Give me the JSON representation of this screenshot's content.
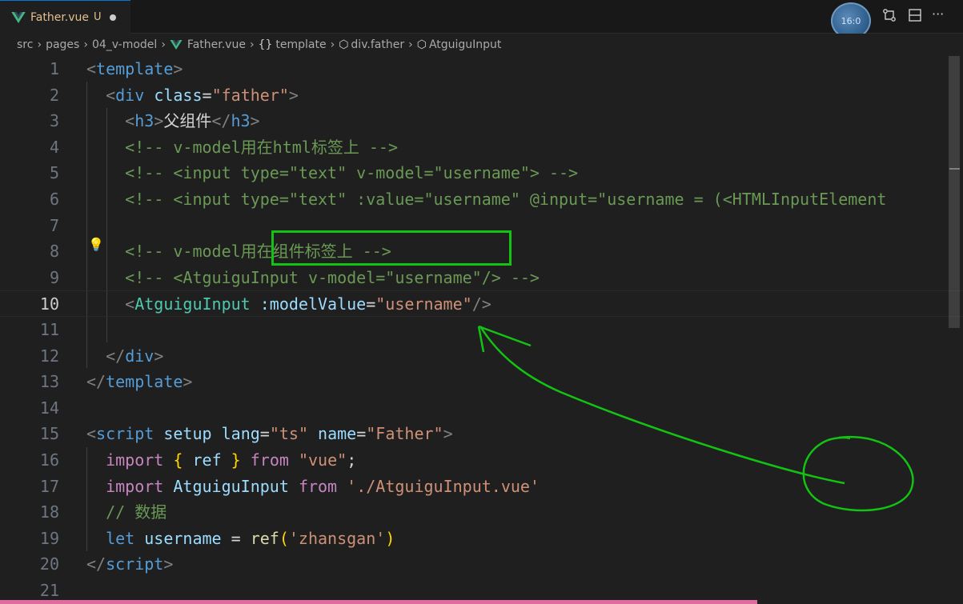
{
  "tab": {
    "title": "Father.vue",
    "badge": "U"
  },
  "avatar": {
    "text": "16:0"
  },
  "breadcrumb": [
    "src",
    "pages",
    "04_v-model",
    "Father.vue",
    "template",
    "div.father",
    "AtguiguInput"
  ],
  "code": {
    "lines": [
      {
        "n": "1",
        "tokens": [
          [
            "tag",
            "<"
          ],
          [
            "name",
            "template"
          ],
          [
            "tag",
            ">"
          ]
        ]
      },
      {
        "n": "2",
        "tokens": [
          [
            "text",
            "  "
          ],
          [
            "tag",
            "<"
          ],
          [
            "name",
            "div"
          ],
          [
            "text",
            " "
          ],
          [
            "attr",
            "class"
          ],
          [
            "text",
            "="
          ],
          [
            "str",
            "\"father\""
          ],
          [
            "tag",
            ">"
          ]
        ]
      },
      {
        "n": "3",
        "tokens": [
          [
            "text",
            "    "
          ],
          [
            "tag",
            "<"
          ],
          [
            "name",
            "h3"
          ],
          [
            "tag",
            ">"
          ],
          [
            "text",
            "父组件"
          ],
          [
            "tag",
            "</"
          ],
          [
            "name",
            "h3"
          ],
          [
            "tag",
            ">"
          ]
        ]
      },
      {
        "n": "4",
        "tokens": [
          [
            "text",
            "    "
          ],
          [
            "com",
            "<!-- v-model用在html标签上 -->"
          ]
        ]
      },
      {
        "n": "5",
        "tokens": [
          [
            "text",
            "    "
          ],
          [
            "com",
            "<!-- <input type=\"text\" v-model=\"username\"> -->"
          ]
        ]
      },
      {
        "n": "6",
        "tokens": [
          [
            "text",
            "    "
          ],
          [
            "com",
            "<!-- <input type=\"text\" :value=\"username\" @input=\"username = (<HTMLInputElement"
          ]
        ]
      },
      {
        "n": "7",
        "tokens": []
      },
      {
        "n": "8",
        "tokens": [
          [
            "text",
            "    "
          ],
          [
            "com",
            "<!-- v-model用在组件标签上 -->"
          ]
        ]
      },
      {
        "n": "9",
        "tokens": [
          [
            "text",
            "    "
          ],
          [
            "com",
            "<!-- <AtguiguInput v-model=\"username\"/> -->"
          ]
        ]
      },
      {
        "n": "10",
        "tokens": [
          [
            "text",
            "    "
          ],
          [
            "tag",
            "<"
          ],
          [
            "comp",
            "AtguiguInput"
          ],
          [
            "text",
            " "
          ],
          [
            "attr",
            ":modelValue"
          ],
          [
            "text",
            "="
          ],
          [
            "str",
            "\"username\""
          ],
          [
            "tag",
            "/>"
          ]
        ]
      },
      {
        "n": "11",
        "tokens": []
      },
      {
        "n": "12",
        "tokens": [
          [
            "text",
            "  "
          ],
          [
            "tag",
            "</"
          ],
          [
            "name",
            "div"
          ],
          [
            "tag",
            ">"
          ]
        ]
      },
      {
        "n": "13",
        "tokens": [
          [
            "tag",
            "</"
          ],
          [
            "name",
            "template"
          ],
          [
            "tag",
            ">"
          ]
        ]
      },
      {
        "n": "14",
        "tokens": []
      },
      {
        "n": "15",
        "tokens": [
          [
            "tag",
            "<"
          ],
          [
            "name",
            "script"
          ],
          [
            "text",
            " "
          ],
          [
            "attr",
            "setup"
          ],
          [
            "text",
            " "
          ],
          [
            "attr",
            "lang"
          ],
          [
            "text",
            "="
          ],
          [
            "str",
            "\"ts\""
          ],
          [
            "text",
            " "
          ],
          [
            "attr",
            "name"
          ],
          [
            "text",
            "="
          ],
          [
            "str",
            "\"Father\""
          ],
          [
            "tag",
            ">"
          ]
        ]
      },
      {
        "n": "16",
        "tokens": [
          [
            "text",
            "  "
          ],
          [
            "kw",
            "import"
          ],
          [
            "text",
            " "
          ],
          [
            "brace",
            "{"
          ],
          [
            "text",
            " "
          ],
          [
            "var",
            "ref"
          ],
          [
            "text",
            " "
          ],
          [
            "brace",
            "}"
          ],
          [
            "text",
            " "
          ],
          [
            "kw",
            "from"
          ],
          [
            "text",
            " "
          ],
          [
            "str",
            "\"vue\""
          ],
          [
            "text",
            ";"
          ]
        ]
      },
      {
        "n": "17",
        "tokens": [
          [
            "text",
            "  "
          ],
          [
            "kw",
            "import"
          ],
          [
            "text",
            " "
          ],
          [
            "var",
            "AtguiguInput"
          ],
          [
            "text",
            " "
          ],
          [
            "kw",
            "from"
          ],
          [
            "text",
            " "
          ],
          [
            "str",
            "'./AtguiguInput.vue'"
          ]
        ]
      },
      {
        "n": "18",
        "tokens": [
          [
            "text",
            "  "
          ],
          [
            "com",
            "// 数据"
          ]
        ]
      },
      {
        "n": "19",
        "tokens": [
          [
            "text",
            "  "
          ],
          [
            "name",
            "let"
          ],
          [
            "text",
            " "
          ],
          [
            "var",
            "username"
          ],
          [
            "text",
            " = "
          ],
          [
            "fn",
            "ref"
          ],
          [
            "brace",
            "("
          ],
          [
            "str",
            "'zhansgan'"
          ],
          [
            "brace",
            ")"
          ]
        ]
      },
      {
        "n": "20",
        "tokens": [
          [
            "tag",
            "</"
          ],
          [
            "name",
            "script"
          ],
          [
            "tag",
            ">"
          ]
        ]
      },
      {
        "n": "21",
        "tokens": []
      }
    ],
    "active_line": "10"
  },
  "colors": {
    "highlight": "#13c213",
    "accent": "#0078d4"
  }
}
